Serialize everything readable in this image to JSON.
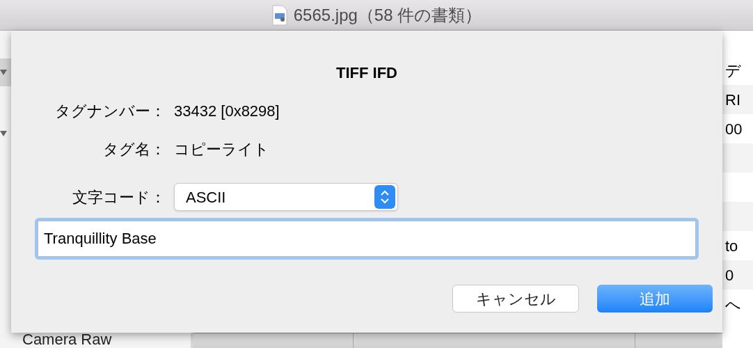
{
  "window": {
    "title": "6565.jpg（58 件の書類）"
  },
  "background": {
    "left_items": [
      {
        "kind": "disclosure"
      },
      {
        "kind": "disclosure"
      },
      {
        "kind": "text",
        "text": "Camera Raw"
      }
    ],
    "right_rows": [
      {
        "text": "デ"
      },
      {
        "text": "RI"
      },
      {
        "text": "00"
      },
      {},
      {},
      {},
      {
        "text": "to"
      },
      {
        "text": "0"
      },
      {
        "text": "へ"
      }
    ]
  },
  "dialog": {
    "title": "TIFF IFD",
    "fields": [
      {
        "kind": "text",
        "label": "タグナンバー：",
        "value": "33432 [0x8298]"
      },
      {
        "kind": "text",
        "label": "タグ名：",
        "value": "コピーライト"
      },
      {
        "kind": "popup",
        "label": "文字コード：",
        "value": "ASCII"
      }
    ],
    "input": {
      "value": "Tranquillity Base",
      "focused": true
    },
    "buttons": [
      {
        "label": "キャンセル",
        "default": false
      },
      {
        "label": "追加",
        "default": true
      }
    ]
  }
}
